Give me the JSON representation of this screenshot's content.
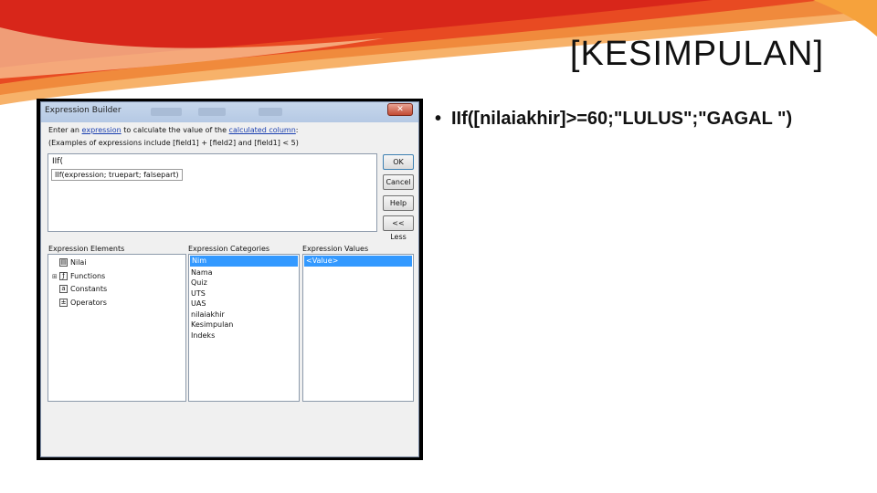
{
  "slide": {
    "title": "[KESIMPULAN]",
    "bullet": "IIf([nilaiakhir]>=60;\"LULUS\";\"GAGAL \")"
  },
  "dialog": {
    "title": "Expression Builder",
    "close_symbol": "✕",
    "instruction_prefix": "Enter an",
    "instruction_link_expression": "expression",
    "instruction_middle": "to calculate the value of the",
    "instruction_link_column": "calculated column",
    "instruction_suffix": ":",
    "examples": "(Examples of expressions include [field1] + [field2] and [field1] < 5)",
    "expression_value": "IIf(",
    "tooltip": "IIf(expression; truepart; falsepart)",
    "buttons": {
      "ok": "OK",
      "cancel": "Cancel",
      "help": "Help",
      "less": "<< Less"
    },
    "elements_label": "Expression Elements",
    "categories_label": "Expression Categories",
    "values_label": "Expression Values",
    "elements": [
      {
        "label": "Nilai",
        "icon": "table-icon",
        "expander": "",
        "glyph": "▤"
      },
      {
        "label": "Functions",
        "icon": "function-icon",
        "expander": "⊞",
        "glyph": "ƒ"
      },
      {
        "label": "Constants",
        "icon": "constants-icon",
        "expander": "",
        "glyph": "a"
      },
      {
        "label": "Operators",
        "icon": "operators-icon",
        "expander": "",
        "glyph": "±"
      }
    ],
    "categories": [
      "Nim",
      "Nama",
      "Quiz",
      "UTS",
      "UAS",
      "nilaiakhir",
      "Kesimpulan",
      "Indeks"
    ],
    "values": [
      "<Value>"
    ]
  }
}
